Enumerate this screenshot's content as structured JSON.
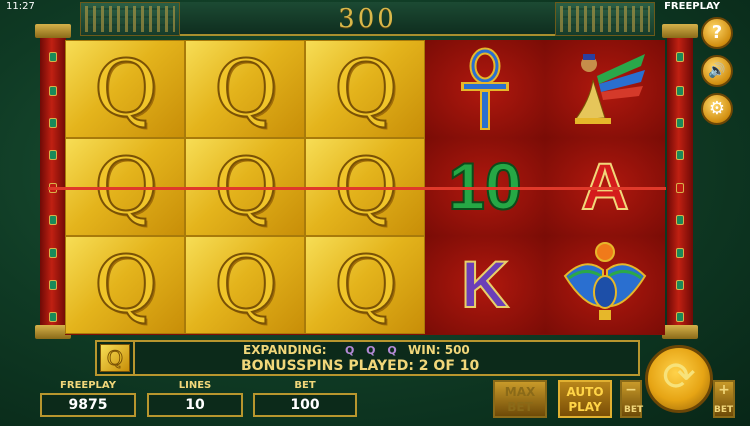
{
  "status_bar": {
    "clock": "11:27",
    "mode_label": "FREEPLAY"
  },
  "header": {
    "win_total": "300"
  },
  "reels": [
    {
      "symbols": [
        {
          "name": "q",
          "label": "Q",
          "expanded": true
        },
        {
          "name": "q",
          "label": "Q",
          "expanded": true
        },
        {
          "name": "q",
          "label": "Q",
          "expanded": true
        }
      ]
    },
    {
      "symbols": [
        {
          "name": "q",
          "label": "Q",
          "expanded": true
        },
        {
          "name": "q",
          "label": "Q",
          "expanded": true
        },
        {
          "name": "q",
          "label": "Q",
          "expanded": true
        }
      ]
    },
    {
      "symbols": [
        {
          "name": "q",
          "label": "Q",
          "expanded": true
        },
        {
          "name": "q",
          "label": "Q",
          "expanded": true
        },
        {
          "name": "q",
          "label": "Q",
          "expanded": true
        }
      ]
    },
    {
      "symbols": [
        {
          "name": "ankh",
          "label": ""
        },
        {
          "name": "ten",
          "label": "10"
        },
        {
          "name": "k",
          "label": "K"
        }
      ]
    },
    {
      "symbols": [
        {
          "name": "isis",
          "label": ""
        },
        {
          "name": "a",
          "label": "A"
        },
        {
          "name": "scarab",
          "label": ""
        }
      ]
    }
  ],
  "side_buttons": [
    {
      "name": "help",
      "icon": "question-icon",
      "glyph": "?"
    },
    {
      "name": "sound",
      "icon": "speaker-icon",
      "glyph": "🔊"
    },
    {
      "name": "settings",
      "icon": "gear-icon",
      "glyph": "⚙"
    }
  ],
  "info_bar": {
    "symbol_label": "Q",
    "expanding_label": "EXPANDING:",
    "expanding_symbols": "Q Q Q",
    "win_label": "WIN: 500",
    "bonus_line": "BONUSSPINS PLAYED: 2 OF 10"
  },
  "stats": {
    "freeplay": {
      "label": "FREEPLAY",
      "value": "9875"
    },
    "lines": {
      "label": "LINES",
      "value": "10"
    },
    "bet": {
      "label": "BET",
      "value": "100"
    }
  },
  "controls": {
    "maxbet_line1": "MAX",
    "maxbet_line2": "BET",
    "autoplay_line1": "AUTO",
    "autoplay_line2": "PLAY",
    "bet_minus_sign": "−",
    "bet_minus_label": "BET",
    "bet_plus_sign": "+",
    "bet_plus_label": "BET",
    "spin_glyph": "⟳"
  },
  "colors": {
    "gold": "#e4b41c",
    "reel_red": "#7d0f08",
    "payline": "#e0392a",
    "table_green": "#1f5a3a"
  }
}
